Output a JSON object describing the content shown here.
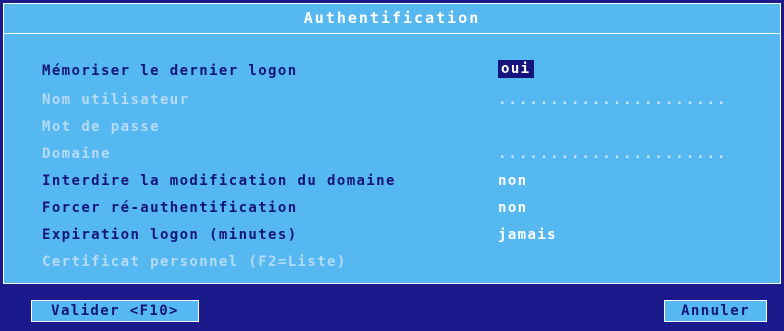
{
  "dialog": {
    "title": "Authentification"
  },
  "fields": [
    {
      "label": "Mémoriser le dernier logon",
      "value": "oui",
      "state": "active",
      "selected": true
    },
    {
      "label": "Nom utilisateur",
      "value": "......................",
      "state": "disabled"
    },
    {
      "label": "Mot de passe",
      "value": "",
      "state": "disabled"
    },
    {
      "label": "Domaine",
      "value": "......................",
      "state": "disabled"
    },
    {
      "label": "Interdire la modification du domaine",
      "value": "non",
      "state": "active"
    },
    {
      "label": "Forcer ré-authentification",
      "value": "non",
      "state": "active"
    },
    {
      "label": "Expiration logon (minutes)",
      "value": "jamais",
      "state": "active"
    },
    {
      "label": "Certificat personnel (F2=Liste)",
      "value": "",
      "state": "disabled"
    }
  ],
  "buttons": {
    "ok_label": "Valider <F10>",
    "cancel_label": "Annuler"
  },
  "colors": {
    "frame": "#1a1a8c",
    "panel": "#56b8f0",
    "active_text": "#14147a",
    "dim_text": "#b5dbf5",
    "value_text": "#ffffff"
  }
}
